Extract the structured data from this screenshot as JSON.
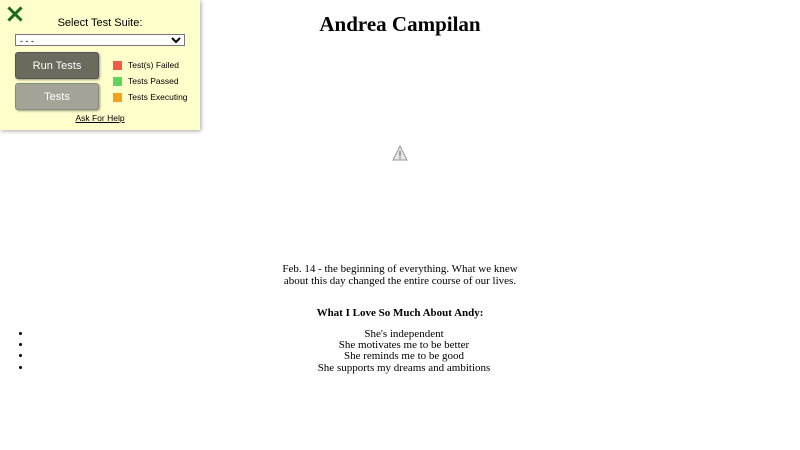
{
  "page": {
    "title": "Andrea Campilan",
    "intro": "Feb. 14 - the beginning of everything. What we knew about this day changed the entire course of our lives.",
    "love_heading": "What I Love So Much About Andy:",
    "love_items": [
      "She's independent",
      "She motivates me to be better",
      "She reminds me to be good",
      "She supports my dreams and ambitions"
    ]
  },
  "test_panel": {
    "close_icon": "close-x-icon",
    "label": "Select Test Suite:",
    "suite_selected": "- - -",
    "run_button": "Run Tests",
    "tests_button": "Tests",
    "legend": [
      {
        "label": "Test(s) Failed",
        "color": "#f05a46"
      },
      {
        "label": "Tests Passed",
        "color": "#5fd65a"
      },
      {
        "label": "Tests Executing",
        "color": "#f5a01e"
      }
    ],
    "help_link": "Ask For Help",
    "colors": {
      "panel_bg": "#ffffcc",
      "close_icon": "#1a6b1a"
    }
  }
}
